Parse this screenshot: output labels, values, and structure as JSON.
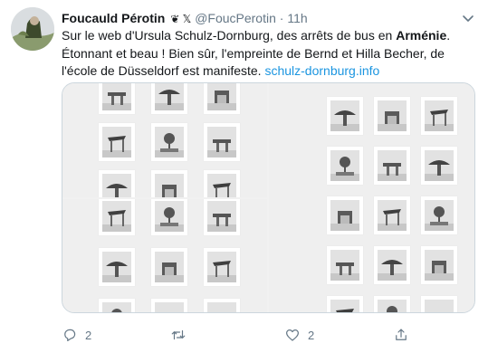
{
  "tweet": {
    "author_name": "Foucauld Pérotin",
    "name_emoji": "❦ 𝕏",
    "handle": "@FoucPerotin",
    "separator": "·",
    "time": "11h",
    "text_line1_start": "Sur le web d'Ursula Schulz-Dornburg, des arrêts de bus en ",
    "text_line1_bold": "Arménie",
    "text_line1_end": ".",
    "text_line2": "Étonnant et beau ! Bien sûr, l'empreinte de Bernd et Hilla Becher, de l'école de Düsseldorf est manifeste. ",
    "text_link": "schulz-dornburg.info"
  },
  "actions": {
    "reply_count": "2",
    "retweet_count": "",
    "like_count": "2",
    "share_count": ""
  },
  "colors": {
    "text": "#14171a",
    "muted": "#657786",
    "link": "#1b95e0",
    "border": "#ccd6dd"
  },
  "icons": [
    "avatar",
    "chevron-down-icon",
    "reply-icon",
    "retweet-icon",
    "like-icon",
    "share-icon"
  ]
}
